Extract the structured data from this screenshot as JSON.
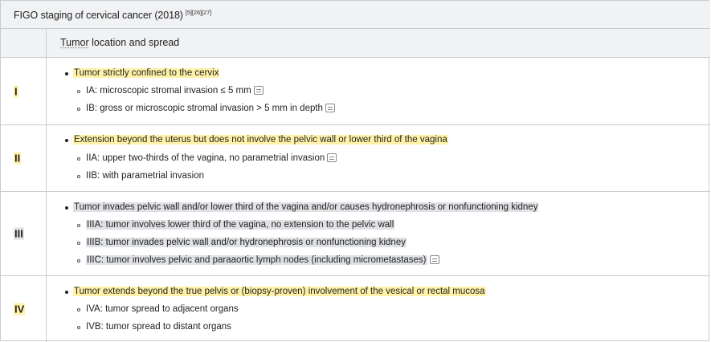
{
  "title": "FIGO staging of cervical cancer (2018)",
  "title_refs": "[5][26][27]",
  "header": {
    "word1": "Tumor",
    "rest": " location and spread"
  },
  "stages": [
    {
      "label": "I",
      "main": "Tumor strictly confined to the cervix",
      "subs": [
        "IA: microscopic stromal invasion ≤ 5 mm",
        "IB: gross or microscopic stromal invasion > 5 mm in depth"
      ]
    },
    {
      "label": "II",
      "main": "Extension beyond the uterus but does not involve the pelvic wall or lower third of the vagina",
      "subs": [
        "IIA: upper two-thirds of the vagina, no parametrial invasion",
        "IIB: with parametrial invasion"
      ]
    },
    {
      "label": "III",
      "main": "Tumor invades pelvic wall and/or lower third of the vagina and/or causes hydronephrosis or nonfunctioning kidney",
      "subs": [
        "IIIA: tumor involves lower third of the vagina, no extension to the pelvic wall",
        "IIIB: tumor invades pelvic wall and/or hydronephrosis or nonfunctioning kidney",
        "IIIC: tumor involves pelvic and paraaortic lymph nodes (including micrometastases)"
      ]
    },
    {
      "label": "IV",
      "main": "Tumor extends beyond the true pelvis or (biopsy-proven) involvement of the vesical or rectal mucosa",
      "subs": [
        "IVA: tumor spread to adjacent organs",
        "IVB: tumor spread to distant organs"
      ]
    }
  ],
  "icons": {
    "note": "note-icon"
  },
  "colors": {
    "highlight_yellow": "#fff2a8",
    "highlight_gray": "#dfe1e5",
    "header_bg": "#f1f2f4",
    "border": "#c8cbcf"
  }
}
